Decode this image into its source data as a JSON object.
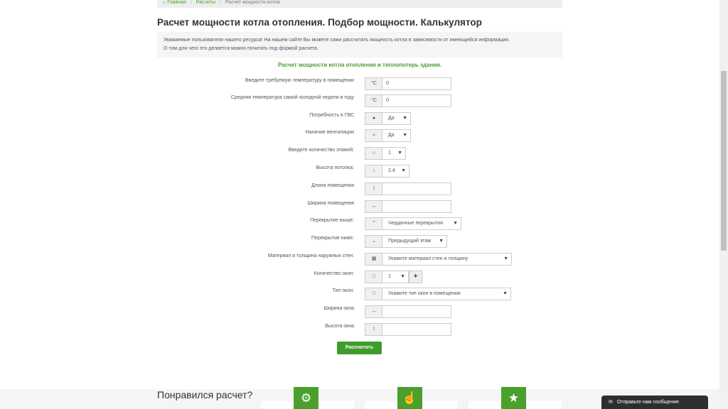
{
  "breadcrumb": {
    "home": "Главная",
    "section": "Расчеты",
    "current": "Расчет мощности котла"
  },
  "title": "Расчет мощности котла отопления. Подбор мощности. Калькулятор",
  "info": {
    "line1": "Уважаемые пользователи нашего ресурса! На нашем сайте Вы можете сами рассчитать мощность котла в зависимости от имеющейся информации.",
    "line2": "О том для чего это делается можно почитать под формой расчета."
  },
  "form_heading": "Расчет мощности котла отопления и теплопотерь здания.",
  "fields": [
    {
      "label": "Введите требуемую температуру в помещении",
      "addon": "°C",
      "value": "0"
    },
    {
      "label": "Средняя температура самой холодной недели в году",
      "addon": "°C",
      "value": "0"
    },
    {
      "label": "Потребность в ГВС",
      "addon_icon": "water-drop-icon",
      "selected": "Да"
    },
    {
      "label": "Наличие вентиляции",
      "addon_icon": "ventilation-icon",
      "selected": "Да"
    },
    {
      "label": "Введите количество этажей:",
      "addon_icon": "home-icon",
      "selected": "1"
    },
    {
      "label": "Высота потолка:",
      "addon_icon": "height-icon",
      "selected": "2.4"
    },
    {
      "label": "Длина помещения",
      "addon_icon": "length-icon",
      "value": ""
    },
    {
      "label": "Ширина помещения",
      "addon_icon": "width-icon",
      "value": ""
    },
    {
      "label": "Перекрытие выше:",
      "addon_icon": "chevron-up-icon",
      "selected": "Чердачные перекрытия"
    },
    {
      "label": "Перекрытие ниже:",
      "addon_icon": "chevron-down-icon",
      "selected": "Предыдущий этаж"
    },
    {
      "label": "Материал и толщина наружных стен:",
      "addon_icon": "wall-icon",
      "selected": "Укажите материал стен и толщину"
    },
    {
      "label": "Количество окон:",
      "addon_icon": "window-icon",
      "selected": "1",
      "plus": "+"
    },
    {
      "label": "Тип окон:",
      "addon_icon": "window-icon",
      "selected": "Укажите тип окон в помещении"
    },
    {
      "label": "Ширина окна",
      "addon_icon": "width-icon",
      "value": ""
    },
    {
      "label": "Высота окна",
      "addon_icon": "height-icon",
      "value": ""
    }
  ],
  "calculate_label": "Рассчитать",
  "liked": "Понравился расчет?",
  "chat": "Отправьте нам сообщение",
  "colors": {
    "accent": "#4aa02c",
    "button": "#3d9c2a",
    "chat": "#2e2e2e"
  }
}
